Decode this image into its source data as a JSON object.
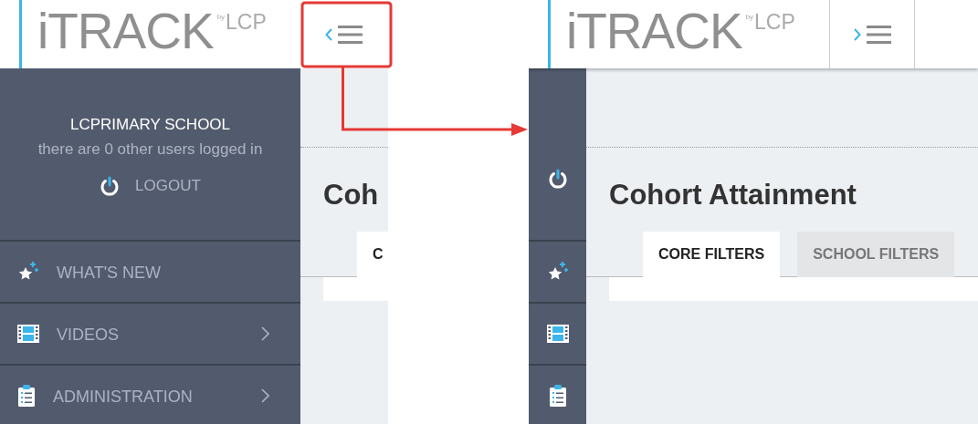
{
  "panels": [
    {
      "sidebar_expanded": true,
      "logo": {
        "wordmark": "iTRACK",
        "by": "by",
        "brand": "LCP"
      },
      "account": {
        "school": "LCPRIMARY SCHOOL",
        "users_note": "there are 0 other users logged in",
        "logout": "LOGOUT"
      },
      "menu": [
        {
          "kind": "labeled",
          "label": "WHAT'S NEW",
          "submenu": false
        },
        {
          "kind": "labeled",
          "label": "VIDEOS",
          "submenu": true
        },
        {
          "kind": "labeled",
          "label": "ADMINISTRATION",
          "submenu": true
        }
      ],
      "page_title": "Coh",
      "tabs": [
        {
          "label": "C",
          "selected": true
        }
      ]
    },
    {
      "sidebar_expanded": false,
      "logo": {
        "wordmark": "iTRACK",
        "by": "by",
        "brand": "LCP"
      },
      "menu": [
        {
          "kind": "icon"
        },
        {
          "kind": "icon"
        },
        {
          "kind": "icon"
        }
      ],
      "page_title": "Cohort Attainment",
      "tabs": [
        {
          "label": "CORE FILTERS",
          "selected": true
        },
        {
          "label": "SCHOOL FILTERS",
          "selected": false
        }
      ]
    }
  ],
  "callout": {
    "kind": "arrow"
  }
}
